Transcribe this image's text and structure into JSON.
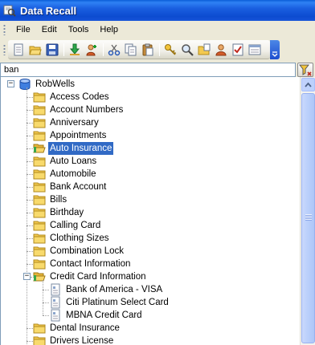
{
  "window": {
    "title": "Data Recall"
  },
  "menu": [
    "File",
    "Edit",
    "Tools",
    "Help"
  ],
  "toolbar": {
    "buttons": [
      "new-document-icon",
      "open-folder-icon",
      "save-icon",
      "separator",
      "download-arrow-icon",
      "user-add-icon",
      "separator",
      "cut-icon",
      "copy-icon",
      "paste-icon",
      "separator",
      "key-icon",
      "find-icon",
      "category-icon",
      "user-icon",
      "checklist-icon",
      "notes-icon"
    ]
  },
  "search": {
    "value": "ban"
  },
  "tree": {
    "root": "RobWells",
    "items": [
      {
        "label": "Access Codes",
        "icon": "folder-icon"
      },
      {
        "label": "Account Numbers",
        "icon": "folder-icon"
      },
      {
        "label": "Anniversary",
        "icon": "folder-icon"
      },
      {
        "label": "Appointments",
        "icon": "folder-icon"
      },
      {
        "label": "Auto Insurance",
        "icon": "folder-open-icon",
        "selected": true
      },
      {
        "label": "Auto Loans",
        "icon": "folder-icon"
      },
      {
        "label": "Automobile",
        "icon": "folder-icon"
      },
      {
        "label": "Bank Account",
        "icon": "folder-icon"
      },
      {
        "label": "Bills",
        "icon": "folder-icon"
      },
      {
        "label": "Birthday",
        "icon": "folder-icon"
      },
      {
        "label": "Calling Card",
        "icon": "folder-icon"
      },
      {
        "label": "Clothing Sizes",
        "icon": "folder-icon"
      },
      {
        "label": "Combination Lock",
        "icon": "folder-icon"
      },
      {
        "label": "Contact Information",
        "icon": "folder-icon"
      },
      {
        "label": "Credit Card Information",
        "icon": "folder-open-icon",
        "expanded": true,
        "children": [
          "Bank of America - VISA",
          "Citi Platinum Select Card",
          "MBNA Credit Card"
        ]
      },
      {
        "label": "Dental Insurance",
        "icon": "folder-icon"
      },
      {
        "label": "Drivers License",
        "icon": "folder-icon"
      }
    ]
  },
  "colors": {
    "selection": "#316ac5",
    "titlebar": "#0c4bd0",
    "folder": "#f3c94f"
  }
}
